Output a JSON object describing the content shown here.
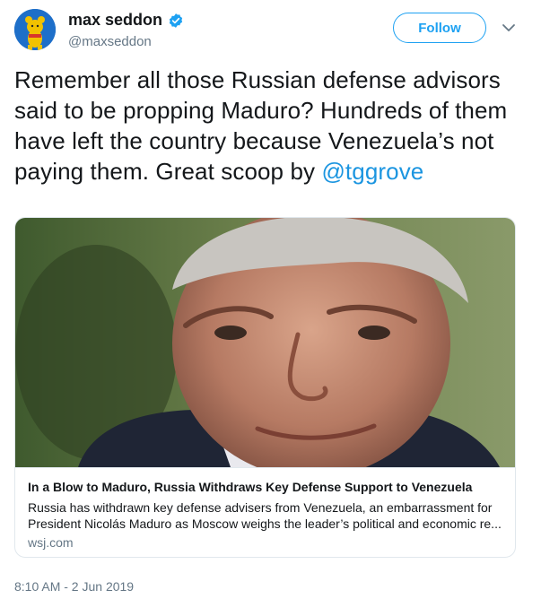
{
  "user": {
    "display_name": "max seddon",
    "handle": "@maxseddon",
    "follow_label": "Follow"
  },
  "tweet": {
    "text_before_mention": "Remember all those Russian defense advisors said to be propping Maduro? Hundreds of them have left the country because Venezuela’s not paying them. Great scoop by ",
    "mention": "@tggrove"
  },
  "card": {
    "title": "In a Blow to Maduro, Russia Withdraws Key Defense Support to Venezuela",
    "description": "Russia has withdrawn key defense advisers from Venezuela, an embarrassment for President Nicolás Maduro as Moscow weighs the leader’s political and economic re...",
    "domain": "wsj.com"
  },
  "timestamp": "8:10 AM - 2 Jun 2019",
  "colors": {
    "accent": "#1da1f2",
    "mention": "#1b95e0",
    "secondary_text": "#657786"
  },
  "icons": [
    "avatar",
    "verified-badge-icon",
    "chevron-down-icon"
  ]
}
